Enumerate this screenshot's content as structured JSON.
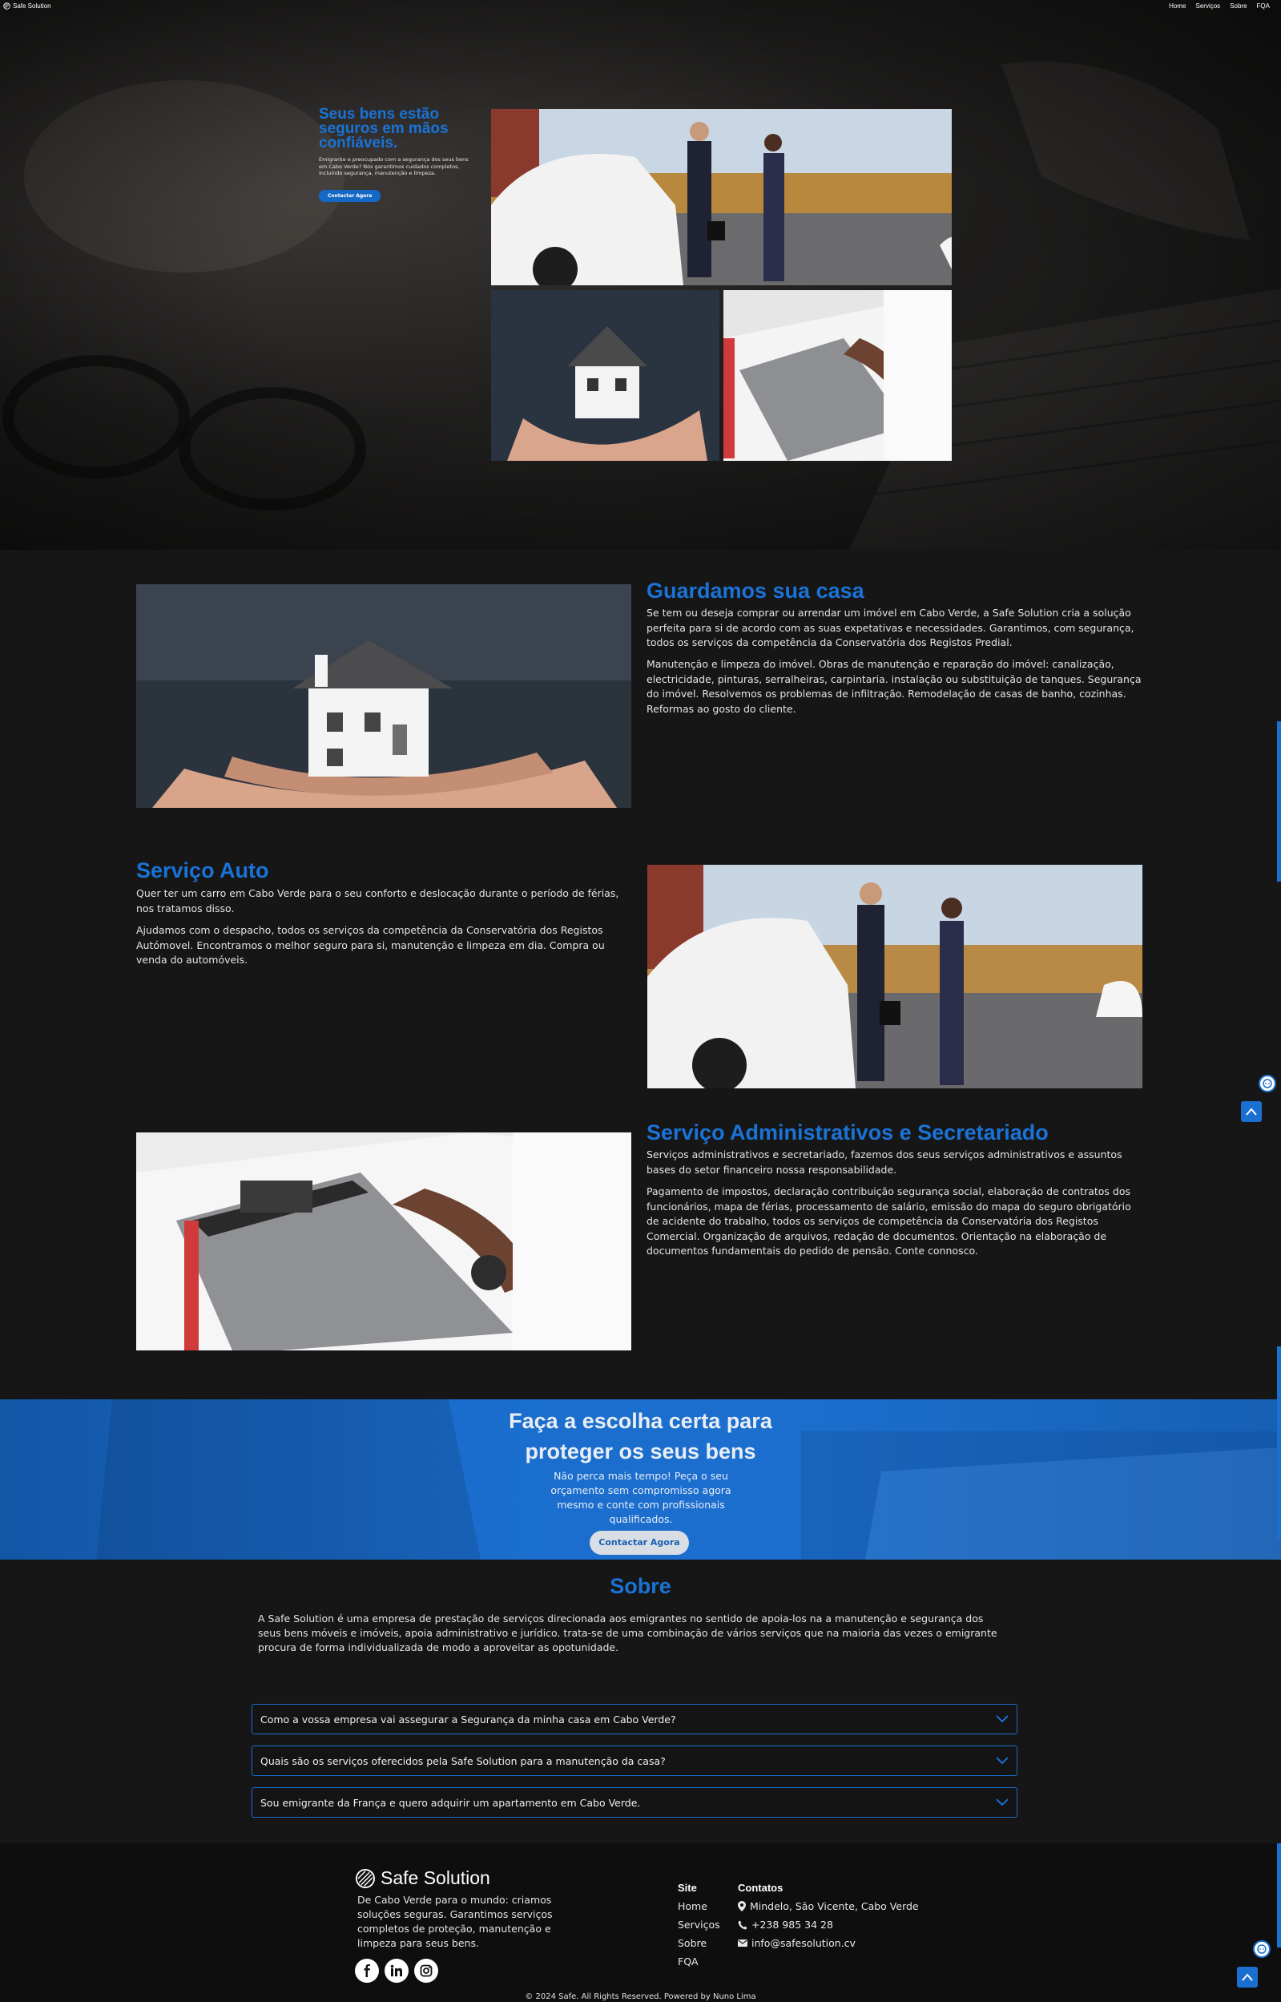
{
  "header": {
    "brand": "Safe Solution",
    "nav": [
      "Home",
      "Serviços",
      "Sobre",
      "FQA"
    ]
  },
  "hero": {
    "title": "Seus bens estão seguros em mãos confiáveis.",
    "description": "Emigrante e preocupado com a segurança dos seus bens em Cabo Verde? Nós garantimos cuidados completos, incluindo segurança, manutenção e limpeza.",
    "button": "Contactar Agora"
  },
  "services": [
    {
      "title": "Guardamos sua casa",
      "paragraphs": [
        "Se tem ou deseja comprar ou arrendar um imóvel em Cabo Verde, a Safe Solution cria a solução perfeita para si de acordo com as suas expetativas e necessidades. Garantimos, com segurança, todos os serviços da competência da Conservatória dos Registos Predial.",
        "Manutenção e limpeza do imóvel. Obras de manutenção e reparação do imóvel: canalização, electricidade, pinturas, serralheiras, carpintaria. instalação ou substituição de tanques. Segurança do imóvel. Resolvemos os problemas de infiltração. Remodelação de casas de banho, cozinhas. Reformas ao gosto do cliente."
      ]
    },
    {
      "title": "Serviço Auto",
      "paragraphs": [
        "Quer ter um carro em Cabo Verde para o seu conforto e deslocação durante o período de férias, nos tratamos disso.",
        "Ajudamos com o despacho, todos os serviços da competência da Conservatória dos Registos Autómovel. Encontramos o melhor seguro para si, manutenção e limpeza em dia. Compra ou venda do automóveis."
      ]
    },
    {
      "title": "Serviço Administrativos e Secretariado",
      "paragraphs": [
        "Serviços administrativos e secretariado, fazemos dos seus serviços administrativos e assuntos bases do setor financeiro nossa responsabilidade.",
        "Pagamento de impostos, declaração contribuição segurança social, elaboração de contratos dos funcionários, mapa de férias, processamento de salário, emissão do mapa do seguro obrigatório de acidente do trabalho, todos os serviços de competência da Conservatória dos Registos Comercial. Organização de arquivos, redação de documentos. Orientação na elaboração de documentos fundamentais do pedido de pensão. Conte connosco."
      ]
    }
  ],
  "cta": {
    "title_line1": "Faça a escolha certa para",
    "title_line2": "proteger os seus bens",
    "description": "Não perca mais tempo! Peça o seu orçamento sem compromisso agora mesmo e conte com profissionais qualificados.",
    "button": "Contactar Agora"
  },
  "about": {
    "title": "Sobre",
    "text": "A Safe Solution é uma empresa de prestação de serviços direcionada aos emigrantes no sentido de apoia-los na a manutenção e segurança dos seus bens móveis e imóveis, apoia administrativo e jurídico. trata-se de uma combinação de vários serviços que na maioria das vezes o emigrante procura de forma individualizada de modo a aproveitar as opotunidade."
  },
  "faq": [
    "Como a vossa empresa vai assegurar a Segurança da minha casa em Cabo Verde?",
    "Quais são os serviços oferecidos pela Safe Solution para a manutenção da casa?",
    "Sou emigrante da França e quero adquirir um apartamento em Cabo Verde."
  ],
  "footer": {
    "brand": "Safe Solution",
    "description": "De Cabo Verde para o mundo: criamos soluções seguras. Garantimos serviços completos de proteção, manutenção e limpeza para seus bens.",
    "site_title": "Site",
    "site_links": [
      "Home",
      "Serviços",
      "Sobre",
      "FQA"
    ],
    "contacts_title": "Contatos",
    "address": "Mindelo, São Vicente, Cabo Verde",
    "phone": "+238 985 34 28",
    "email": "info@safesolution.cv",
    "copyright": "© 2024 Safe. All Rights Reserved. Powered by Nuno Lima"
  },
  "icons": {
    "brand": "globe-logo-icon",
    "faq_toggle": "chevron-down-icon",
    "social": [
      "facebook-icon",
      "linkedin-icon",
      "instagram-icon"
    ],
    "contact": [
      "map-pin-icon",
      "phone-icon",
      "mail-icon"
    ],
    "floating": [
      "scroll-top-icon",
      "chat-icon"
    ]
  },
  "colors": {
    "accent": "#1a73d6",
    "page_background": "#161617",
    "cta_background": "#1c6fcf",
    "footer_background": "#0e0e0e"
  }
}
